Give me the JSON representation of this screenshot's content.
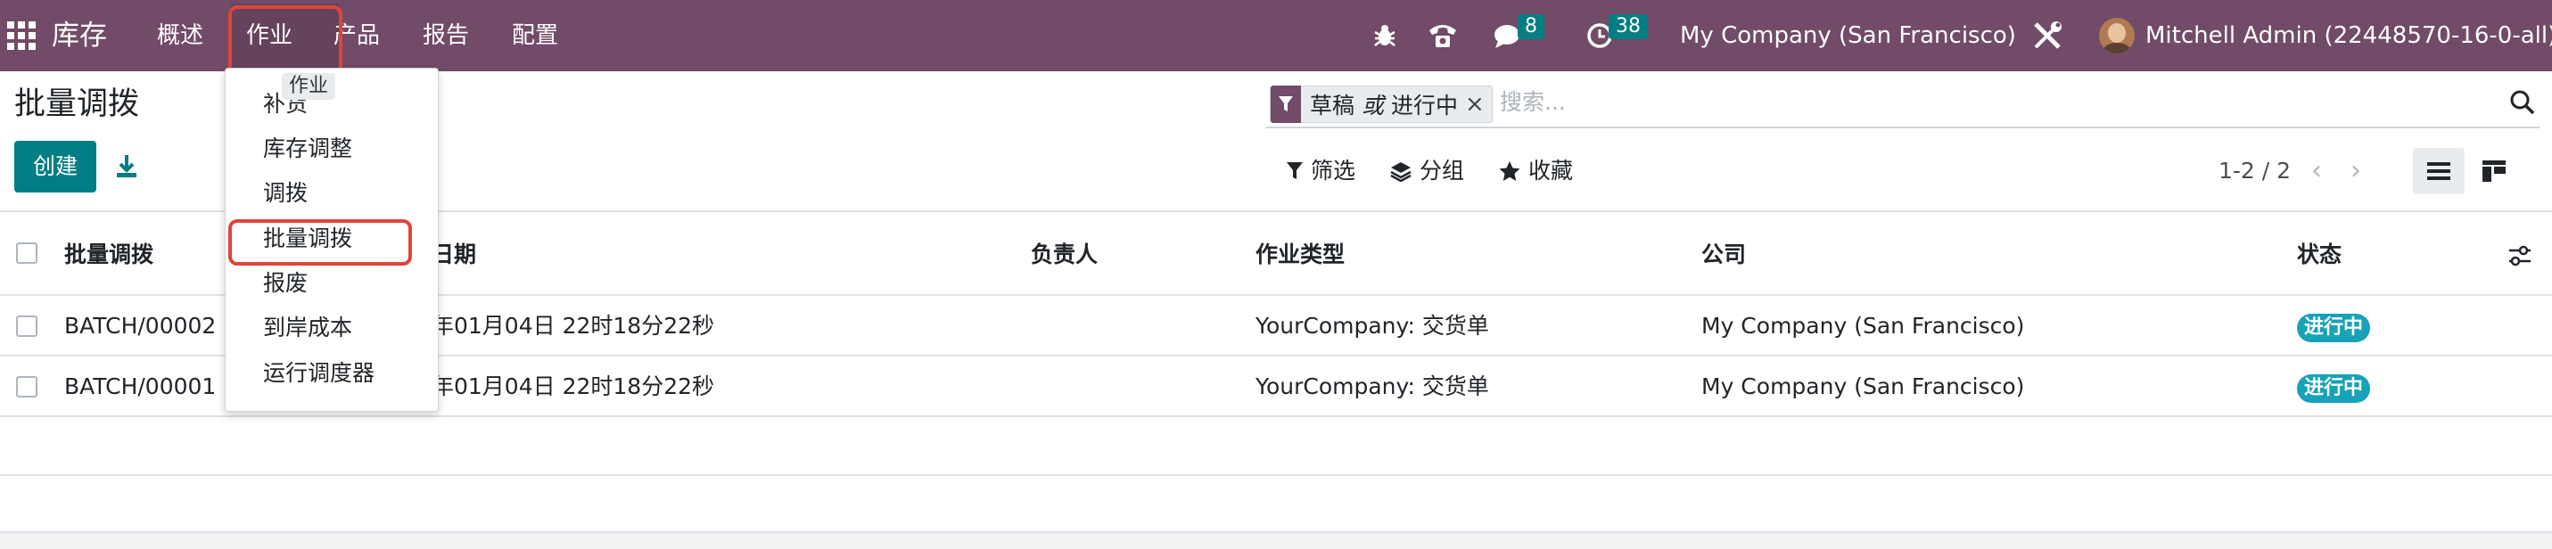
{
  "navbar": {
    "app_name": "库存",
    "menu": [
      "概述",
      "作业",
      "产品",
      "报告",
      "配置"
    ],
    "active_menu_tooltip": "作业",
    "messages_count": "8",
    "activities_count": "38",
    "company": "My Company (San Francisco)",
    "user": "Mitchell Admin (22448570-16-0-all)",
    "accent_color": "#714b67"
  },
  "dropdown": {
    "items": [
      "补货",
      "库存调整",
      "调拨",
      "批量调拨",
      "报废",
      "到岸成本",
      "运行调度器"
    ],
    "highlighted": "批量调拨"
  },
  "control_panel": {
    "title": "批量调拨",
    "create_label": "创建",
    "facet": {
      "part1": "草稿",
      "or": "或",
      "part2": "进行中"
    },
    "search_placeholder": "搜索...",
    "filter_label": "筛选",
    "group_label": "分组",
    "favorite_label": "收藏",
    "pager": "1-2 / 2"
  },
  "table": {
    "columns": [
      "批量调拨",
      "日期",
      "负责人",
      "作业类型",
      "公司",
      "状态"
    ],
    "rows": [
      {
        "name": "BATCH/00002",
        "date": "年01月04日 22时18分22秒",
        "responsible": "",
        "operation_type": "YourCompany: 交货单",
        "company": "My Company (San Francisco)",
        "status": "进行中"
      },
      {
        "name": "BATCH/00001",
        "date": "年01月04日 22时18分22秒",
        "responsible": "",
        "operation_type": "YourCompany: 交货单",
        "company": "My Company (San Francisco)",
        "status": "进行中"
      }
    ]
  },
  "icons": [
    "apps-grid-icon",
    "bug-icon",
    "phone-icon",
    "chat-icon",
    "clock-icon",
    "tools-icon",
    "download-icon",
    "filter-icon",
    "layers-icon",
    "star-icon",
    "search-icon",
    "chevron-left-icon",
    "chevron-right-icon",
    "list-view-icon",
    "kanban-view-icon",
    "settings-sliders-icon"
  ]
}
